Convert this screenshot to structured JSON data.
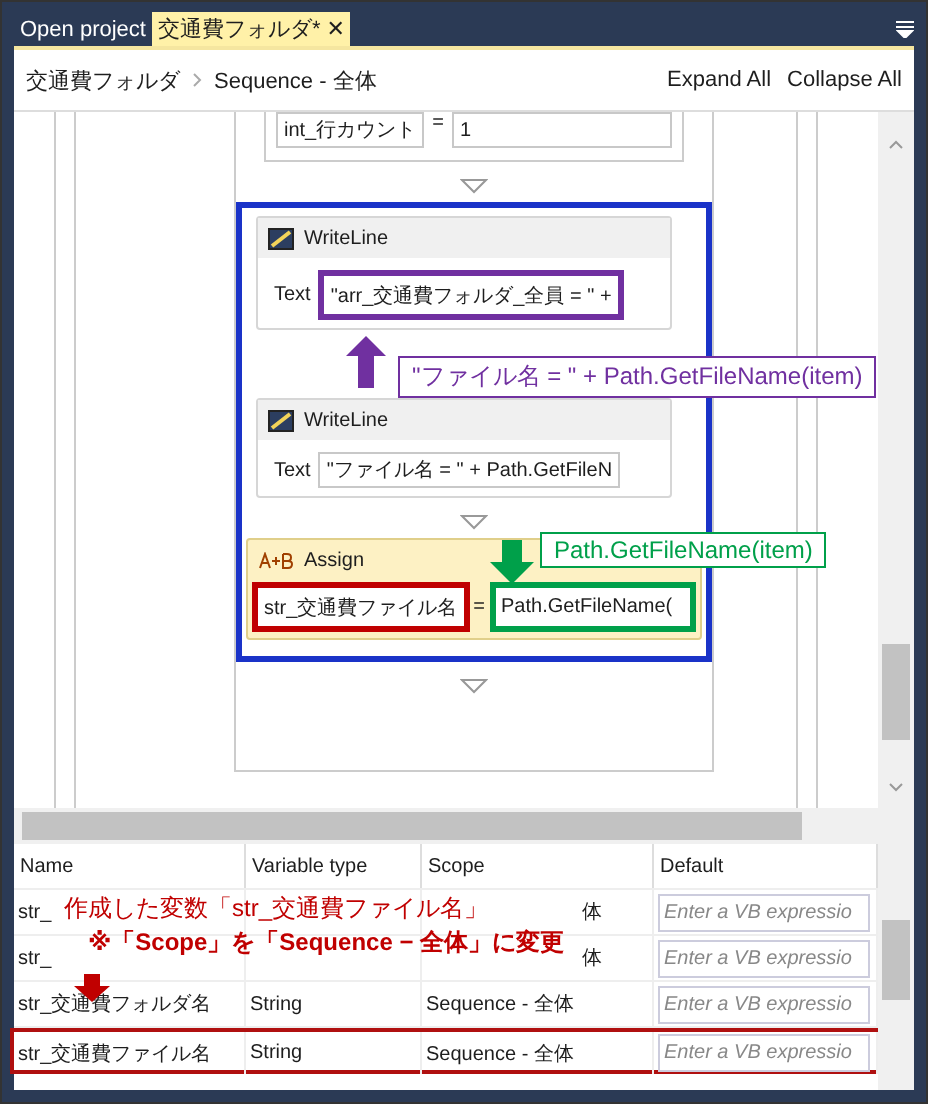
{
  "tabs": [
    {
      "label": "Open project",
      "selected": false
    },
    {
      "label": "交通費フォルダ*",
      "selected": true,
      "close": "✕"
    }
  ],
  "breadcrumb": [
    "交通費フォルダ",
    "Sequence - 全体"
  ],
  "toolbar": [
    "Expand All",
    "Collapse All"
  ],
  "activities": [
    {
      "kind": "assign_cut",
      "operator": "=",
      "fields": [
        {
          "value": "int_行カウント"
        },
        {
          "value": "1"
        }
      ]
    },
    {
      "kind": "writeline",
      "title": "WriteLine",
      "label": "Text",
      "fields": [
        {
          "value": "\"arr_交通費フォルダ_全員 = \" +",
          "color": "#7030a0"
        }
      ]
    },
    {
      "kind": "writeline",
      "title": "WriteLine",
      "label": "Text",
      "fields": [
        {
          "value": "\"ファイル名 = \" + Path.GetFileN"
        }
      ]
    },
    {
      "kind": "assign",
      "title": "Assign",
      "operator": "=",
      "fields": [
        {
          "value": "str_交通費ファイル名",
          "color": "#c00000"
        },
        {
          "value": "Path.GetFileName(",
          "color": "#00a04a"
        }
      ]
    }
  ],
  "callouts": [
    {
      "text": "\"ファイル名 = \" + Path.GetFileName(item)",
      "color": "#7030a0"
    },
    {
      "text": "Path.GetFileName(item)",
      "color": "#00a04a"
    }
  ],
  "variables": {
    "columns": [
      "Name",
      "Variable type",
      "Scope",
      "Default"
    ],
    "rows": [
      {
        "name": "str_",
        "type": "",
        "scope": "体",
        "placeholder": "Enter a VB expressio",
        "highlighted": false
      },
      {
        "name": "str_",
        "type": "",
        "scope": "体",
        "placeholder": "Enter a VB expressio",
        "highlighted": false
      },
      {
        "name": "str_交通費フォルダ名",
        "type": "String",
        "scope": "Sequence - 全体",
        "placeholder": "Enter a VB expressio",
        "highlighted": false
      },
      {
        "name": "str_交通費ファイル名",
        "type": "String",
        "scope": "Sequence - 全体",
        "placeholder": "Enter a VB expressio",
        "highlighted": true
      }
    ],
    "note": [
      "作成した変数「str_交通費ファイル名」",
      "※「Scope」を「Sequence − 全体」に変更"
    ]
  }
}
